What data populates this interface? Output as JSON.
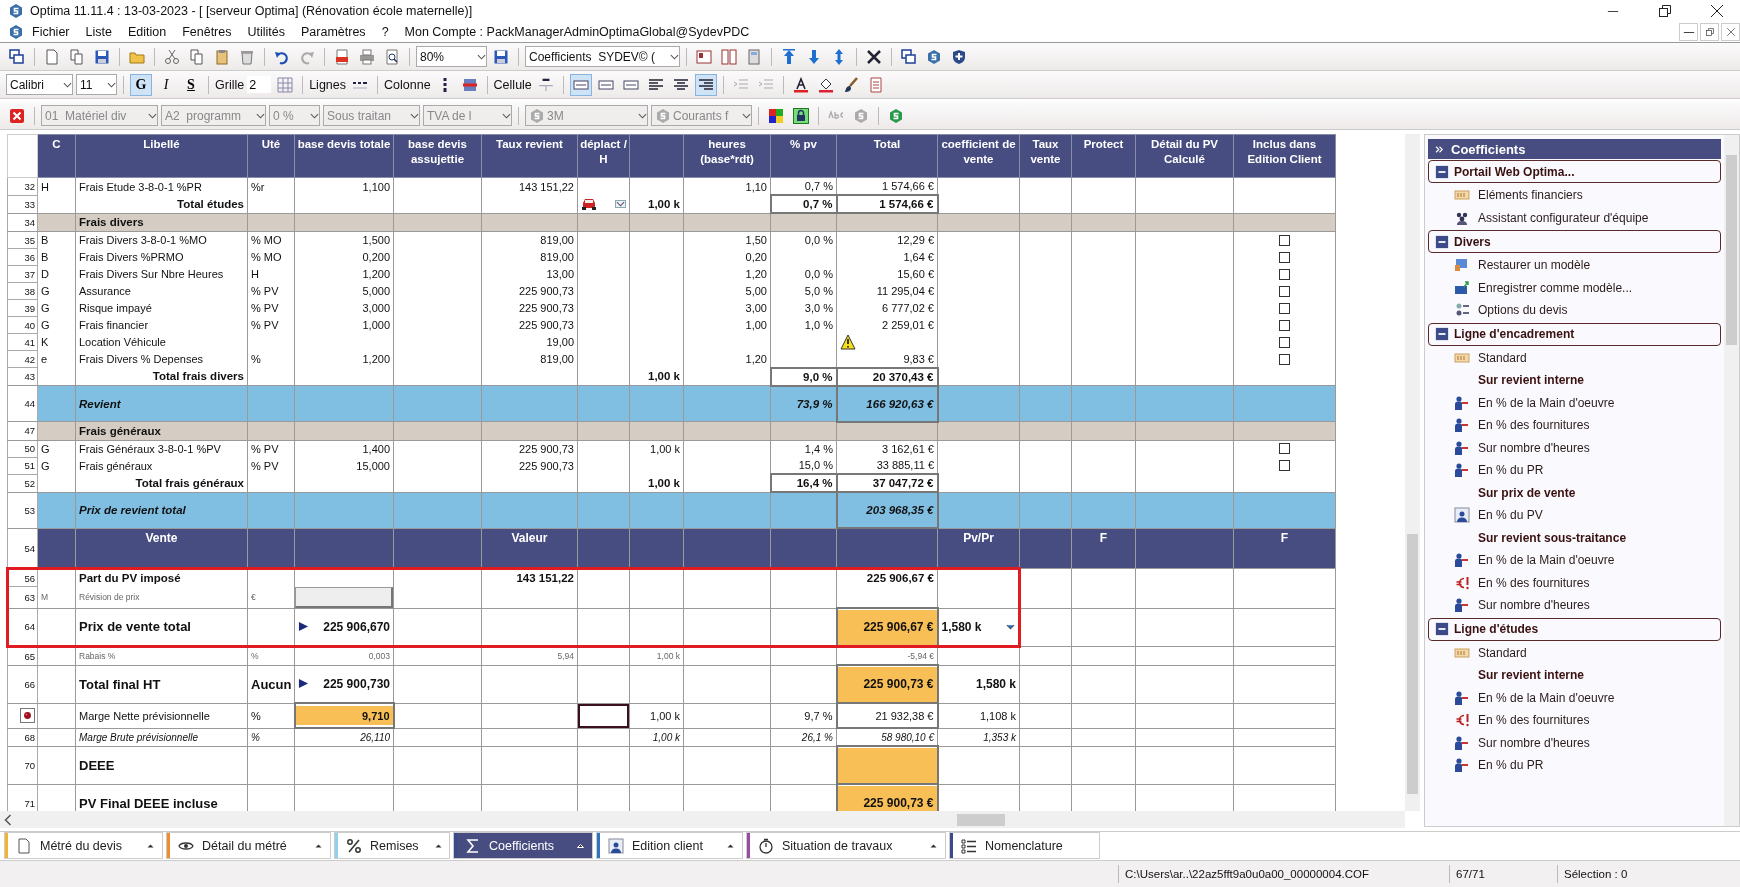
{
  "window": {
    "title": "Optima 11.11.4 : 13-03-2023 - [ [serveur Optima] (Rénovation école maternelle)]"
  },
  "menu": {
    "items": [
      "Fichier",
      "Liste",
      "Edition",
      "Fenêtres",
      "Utilités",
      "Paramètres",
      "?"
    ],
    "account": "Mon Compte : PackManagerAdminOptimaGlobal@SydevPDC"
  },
  "toolbar": {
    "zoom": "80%",
    "preset": "Coefficients  SYDEV© ("
  },
  "format_bar": {
    "font": "Calibri",
    "size": "11",
    "styles": [
      {
        "label": "G",
        "selected": true
      },
      {
        "label": "I",
        "selected": false
      },
      {
        "label": "S",
        "selected": false
      }
    ],
    "grid_label": "Grille",
    "grid_value": "2",
    "lines_label": "Lignes",
    "column_label": "Colonne",
    "cell_label": "Cellule",
    "line_styles": [
      {
        "selected": true
      },
      {
        "selected": false
      },
      {
        "selected": false
      }
    ],
    "alignments": [
      {
        "selected": false
      },
      {
        "selected": false
      },
      {
        "selected": true
      }
    ]
  },
  "filter_bar": {
    "dropdowns": [
      {
        "value": "01  Matériel div",
        "kind": "plain"
      },
      {
        "value": "A2  programm",
        "kind": "plain"
      },
      {
        "value": "0 %",
        "kind": "plain"
      },
      {
        "value": "Sous traitan",
        "kind": "plain"
      },
      {
        "value": "TVA de l",
        "kind": "plain"
      },
      {
        "value": "3M",
        "kind": "logo"
      },
      {
        "value": "Courants f",
        "kind": "logo"
      }
    ]
  },
  "table": {
    "columns": [
      {
        "label": "C"
      },
      {
        "label": "Libellé"
      },
      {
        "label": "Uté"
      },
      {
        "label": "base devis totale"
      },
      {
        "label": "base devis assujettie"
      },
      {
        "label": "Taux revient"
      },
      {
        "label": "déplact / H"
      },
      {},
      {
        "label": "heures (base*rdt)"
      },
      {
        "label": "% pv"
      },
      {
        "label": "Total"
      },
      {
        "label": "coefficient de vente"
      },
      {
        "label": "Taux vente"
      },
      {
        "label": "Protect"
      },
      {
        "label": "Détail du PV Calculé"
      },
      {
        "label": "Inclus dans Edition Client"
      }
    ],
    "rows": [
      {
        "num": "32",
        "kind": "data",
        "cells": [
          "H",
          "Frais Etude 3-8-0-1 %PR",
          "%r",
          "1,100",
          null,
          "143 151,22",
          null,
          null,
          "1,10",
          "0,7 %",
          "1 574,66 €"
        ]
      },
      {
        "num": "33",
        "kind": "total",
        "cells": [
          null,
          "Total études",
          null,
          null,
          null,
          null,
          {
            "kind": "vehicle-select"
          },
          "1,00 k",
          null,
          {
            "text": "0,7 %",
            "boxed": true
          },
          {
            "text": "1 574,66 €",
            "boxed": true
          }
        ]
      },
      {
        "num": "34",
        "kind": "section",
        "cells": [
          null,
          "Frais divers"
        ]
      },
      {
        "num": "35",
        "kind": "data",
        "cells": [
          "B",
          "Frais Divers 3-8-0-1 %MO",
          "% MO",
          "1,500",
          null,
          "819,00",
          null,
          null,
          "1,50",
          "0,0 %",
          "12,29 €",
          null,
          null,
          null,
          null,
          {
            "kind": "checkbox",
            "checked": false
          }
        ]
      },
      {
        "num": "36",
        "kind": "data",
        "cells": [
          "B",
          "Frais Divers %PRMO",
          "% MO",
          "0,200",
          null,
          "819,00",
          null,
          null,
          "0,20",
          null,
          "1,64 €",
          null,
          null,
          null,
          null,
          {
            "kind": "checkbox",
            "checked": false
          }
        ]
      },
      {
        "num": "37",
        "kind": "data",
        "cells": [
          "D",
          "Frais Divers Sur Nbre Heures",
          "H",
          "1,200",
          null,
          "13,00",
          null,
          null,
          "1,20",
          "0,0 %",
          "15,60 €",
          null,
          null,
          null,
          null,
          {
            "kind": "checkbox",
            "checked": false
          }
        ]
      },
      {
        "num": "38",
        "kind": "data",
        "cells": [
          "G",
          "Assurance",
          "% PV",
          "5,000",
          null,
          "225 900,73",
          null,
          null,
          "5,00",
          "5,0 %",
          "11 295,04 €",
          null,
          null,
          null,
          null,
          {
            "kind": "checkbox",
            "checked": false
          }
        ]
      },
      {
        "num": "39",
        "kind": "data",
        "cells": [
          "G",
          "Risque impayé",
          "% PV",
          "3,000",
          null,
          "225 900,73",
          null,
          null,
          "3,00",
          "3,0 %",
          "6 777,02 €",
          null,
          null,
          null,
          null,
          {
            "kind": "checkbox",
            "checked": false
          }
        ]
      },
      {
        "num": "40",
        "kind": "data",
        "cells": [
          "G",
          "Frais financier",
          "% PV",
          "1,000",
          null,
          "225 900,73",
          null,
          null,
          "1,00",
          "1,0 %",
          "2 259,01 €",
          null,
          null,
          null,
          null,
          {
            "kind": "checkbox",
            "checked": false
          }
        ]
      },
      {
        "num": "41",
        "kind": "data",
        "cells": [
          "K",
          "Location Véhicule",
          null,
          null,
          null,
          "19,00",
          null,
          null,
          null,
          null,
          {
            "kind": "warning"
          },
          null,
          null,
          null,
          null,
          {
            "kind": "checkbox",
            "checked": false
          }
        ]
      },
      {
        "num": "42",
        "kind": "data",
        "cells": [
          "e",
          "Frais Divers % Depenses",
          "%",
          "1,200",
          null,
          "819,00",
          null,
          null,
          "1,20",
          null,
          "9,83 €",
          null,
          null,
          null,
          null,
          {
            "kind": "checkbox",
            "checked": false
          }
        ]
      },
      {
        "num": "43",
        "kind": "total",
        "cells": [
          null,
          "Total frais divers",
          null,
          null,
          null,
          null,
          null,
          "1,00 k",
          null,
          {
            "text": "9,0 %",
            "boxed": true
          },
          {
            "text": "20 370,43 €",
            "boxed": true
          }
        ]
      },
      {
        "num": "44",
        "kind": "summary",
        "cells": [
          null,
          "Revient",
          null,
          null,
          null,
          null,
          null,
          null,
          null,
          "73,9 %",
          {
            "text": "166 920,63 €",
            "boxed": true
          }
        ]
      },
      {
        "num": "47",
        "kind": "section",
        "cells": [
          null,
          "Frais généraux"
        ]
      },
      {
        "num": "50",
        "kind": "data",
        "cells": [
          "G",
          "Frais Généraux 3-8-0-1 %PV",
          "% PV",
          "1,400",
          null,
          "225 900,73",
          null,
          "1,00 k",
          null,
          "1,4 %",
          "3 162,61 €",
          null,
          null,
          null,
          null,
          {
            "kind": "checkbox",
            "checked": false
          }
        ]
      },
      {
        "num": "51",
        "kind": "data",
        "cells": [
          "G",
          "Frais généraux",
          "% PV",
          "15,000",
          null,
          "225 900,73",
          null,
          null,
          null,
          "15,0 %",
          "33 885,11 €",
          null,
          null,
          null,
          null,
          {
            "kind": "checkbox",
            "checked": false
          }
        ]
      },
      {
        "num": "52",
        "kind": "total",
        "cells": [
          null,
          "Total frais généraux",
          null,
          null,
          null,
          null,
          null,
          "1,00 k",
          null,
          {
            "text": "16,4 %",
            "boxed": true
          },
          {
            "text": "37 047,72 €",
            "boxed": true
          }
        ]
      },
      {
        "num": "53",
        "kind": "summary",
        "cells": [
          null,
          "Prix de revient total",
          null,
          null,
          null,
          null,
          null,
          null,
          null,
          null,
          {
            "text": "203 968,35 €",
            "boxed": true
          }
        ]
      },
      {
        "num": "54",
        "kind": "header",
        "cells": [
          null,
          "Vente",
          null,
          null,
          null,
          "Valeur",
          null,
          null,
          null,
          null,
          null,
          "Pv/Pr",
          null,
          "F",
          null,
          "F"
        ]
      },
      {
        "num": "56",
        "kind": "part",
        "framed": true,
        "cells": [
          null,
          "Part du PV imposé",
          null,
          null,
          null,
          "143 151,22",
          null,
          null,
          null,
          null,
          "225 906,67 €"
        ]
      },
      {
        "num": "63",
        "kind": "small",
        "framed": true,
        "cells": [
          "M",
          "Révision de prix",
          "€",
          {
            "kind": "field"
          }
        ]
      },
      {
        "num": "64",
        "kind": "major",
        "framed": true,
        "cells": [
          null,
          "Prix de vente total",
          null,
          {
            "text": "225 906,670",
            "marker": true
          },
          null,
          null,
          null,
          null,
          null,
          null,
          {
            "text": "225 906,67 €",
            "highlight": true
          },
          {
            "text": "1,580 k",
            "dropdown": true
          }
        ]
      },
      {
        "num": "65",
        "kind": "small",
        "cells": [
          null,
          "Rabais %",
          "%",
          "0,003",
          null,
          "5,94",
          null,
          "1,00 k",
          null,
          null,
          "-5,94 €"
        ]
      },
      {
        "num": "66",
        "kind": "major",
        "cells": [
          null,
          "Total final HT",
          "Aucun",
          {
            "text": "225 900,730",
            "marker": true
          },
          null,
          null,
          null,
          null,
          null,
          null,
          {
            "text": "225 900,73 €",
            "highlight": true
          },
          "1,580 k"
        ]
      },
      {
        "kind": "note",
        "current": true,
        "cells": [
          null,
          "Marge Nette prévisionnelle",
          "%",
          {
            "text": "9,710",
            "highlight": true
          },
          null,
          null,
          {
            "kind": "focused"
          },
          "1,00 k",
          null,
          "9,7 %",
          {
            "text": "21 932,38 €",
            "boxed": true
          },
          "1,108 k"
        ]
      },
      {
        "num": "68",
        "kind": "italic",
        "cells": [
          null,
          "Marge Brute prévisionnelle",
          "%",
          "26,110",
          null,
          null,
          null,
          "1,00 k",
          null,
          "26,1 %",
          "58 980,10 €",
          "1,353 k"
        ]
      },
      {
        "num": "70",
        "kind": "major",
        "cells": [
          null,
          "DEEE",
          null,
          null,
          null,
          null,
          null,
          null,
          null,
          null,
          {
            "highlight": true
          }
        ]
      },
      {
        "num": "71",
        "kind": "major",
        "cells": [
          null,
          "PV Final DEEE incluse",
          null,
          null,
          null,
          null,
          null,
          null,
          null,
          null,
          {
            "text": "225 900,73 €",
            "highlight": true
          }
        ]
      }
    ]
  },
  "sidebar": {
    "title": "Coefficients",
    "groups": [
      {
        "label": "Portail Web Optima...",
        "expanded": true,
        "items": [
          {
            "label": "Eléments financiers",
            "kind": "action"
          },
          {
            "label": "Assistant configurateur d'équipe",
            "kind": "action"
          }
        ]
      },
      {
        "label": "Divers",
        "expanded": true,
        "items": [
          {
            "label": "Restaurer un modèle",
            "kind": "action"
          },
          {
            "label": "Enregistrer comme modèle...",
            "kind": "action"
          },
          {
            "label": "Options du devis",
            "kind": "action"
          }
        ]
      },
      {
        "label": "Ligne d'encadrement",
        "expanded": true,
        "items": [
          {
            "label": "Standard",
            "kind": "action"
          },
          {
            "label": "Sur revient interne",
            "kind": "heading"
          },
          {
            "label": "En % de la Main d'oeuvre",
            "kind": "action"
          },
          {
            "label": "En % des fournitures",
            "kind": "action"
          },
          {
            "label": "Sur nombre d'heures",
            "kind": "action"
          },
          {
            "label": "En % du PR",
            "kind": "action"
          },
          {
            "label": "Sur prix de vente",
            "kind": "heading"
          },
          {
            "label": "En % du PV",
            "kind": "action"
          },
          {
            "label": "Sur revient sous-traitance",
            "kind": "heading"
          },
          {
            "label": "En % de la Main d'oeuvre",
            "kind": "action"
          },
          {
            "label": "En % des fournitures",
            "kind": "action"
          },
          {
            "label": "Sur nombre d'heures",
            "kind": "action"
          }
        ]
      },
      {
        "label": "Ligne d'études",
        "expanded": true,
        "items": [
          {
            "label": "Standard",
            "kind": "action"
          },
          {
            "label": "Sur revient interne",
            "kind": "heading"
          },
          {
            "label": "En % de la Main d'oeuvre",
            "kind": "action"
          },
          {
            "label": "En % des fournitures",
            "kind": "action"
          },
          {
            "label": "Sur nombre d'heures",
            "kind": "action"
          },
          {
            "label": "En % du PR",
            "kind": "action"
          }
        ]
      }
    ]
  },
  "tabs": [
    {
      "label": "Métré du devis",
      "selected": false,
      "color": "#f2b233"
    },
    {
      "label": "Détail du métré",
      "selected": false,
      "color": "#f08c2a"
    },
    {
      "label": "Remises",
      "selected": false,
      "color": "#8fd0ee"
    },
    {
      "label": "Coefficients",
      "selected": true,
      "color": "#3b4a8a"
    },
    {
      "label": "Edition client",
      "selected": false,
      "color": "#2f74c0"
    },
    {
      "label": "Situation de travaux",
      "selected": false,
      "color": "#9a4aa0"
    },
    {
      "label": "Nomenclature",
      "selected": false,
      "color": "#3b4a8a"
    }
  ],
  "status_bar": {
    "path": "C:\\Users\\ar..\\22az5fft9a0u0a00_00000004.COF",
    "position": "67/71",
    "selection": "Sélection : 0"
  }
}
